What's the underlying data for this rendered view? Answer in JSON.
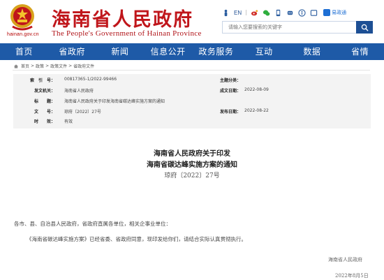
{
  "header": {
    "site_domain": "hainan.gov.cn",
    "title_cn": "海南省人民政府",
    "title_en": "The People's Government of Hainan Province",
    "lang_label": "EN",
    "app_label": "易政通",
    "search_placeholder": "请输入您要搜索的关键字"
  },
  "nav": {
    "items": [
      "首页",
      "省政府",
      "新闻",
      "信息公开",
      "政务服务",
      "互动",
      "数据",
      "省情"
    ]
  },
  "breadcrumb": [
    "首页",
    "政策",
    "政策文件",
    "省政府文件"
  ],
  "info": {
    "index_label": "索　引　号：",
    "index_value": "00817365-1/2022-99466",
    "subject_label": "主题分类：",
    "subject_value": "",
    "issuer_label": "发文机关：",
    "issuer_value": "海南省人民政府",
    "created_label": "成文日期：",
    "created_value": "2022-08-09",
    "title_label": "标　　题：",
    "title_value": "海南省人民政府关于印发海南省碳达峰实施方案的通知",
    "docno_label": "文　　号：",
    "docno_value": "琼府〔2022〕27号",
    "published_label": "发布日期：",
    "published_value": "2022-08-22",
    "validity_label": "时　　效：",
    "validity_value": "有效"
  },
  "document": {
    "title_line1": "海南省人民政府关于印发",
    "title_line2": "海南省碳达峰实施方案的通知",
    "doc_number": "琼府〔2022〕27号",
    "recipients": "各市、县、自治县人民政府，省政府直属各单位，相关企事业单位：",
    "body": "《海南省碳达峰实施方案》已经省委、省政府同意，现印发给你们，请结合实际认真贯彻执行。",
    "signature": "海南省人民政府",
    "date": "2022年8月5日"
  },
  "colors": {
    "brand_red": "#c0161b",
    "nav_blue": "#1e5aa7",
    "search_blue": "#1d4f94"
  }
}
